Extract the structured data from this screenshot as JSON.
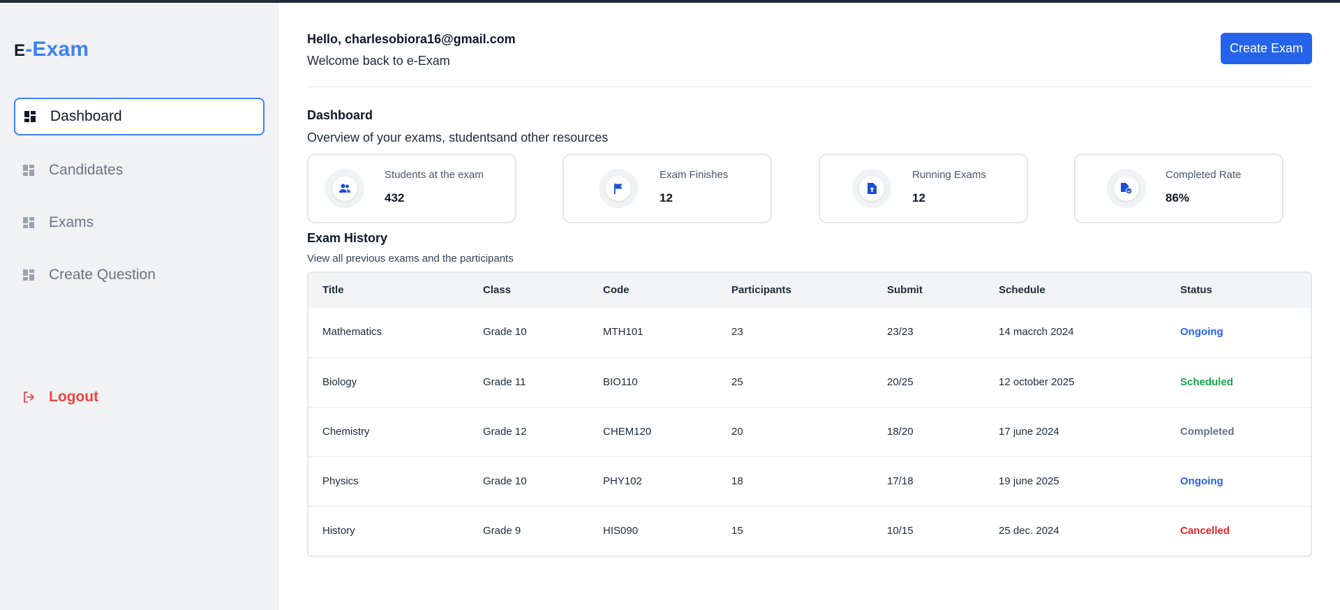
{
  "brand": {
    "prefix": "E",
    "rest": "-Exam",
    "accent": "#3b82f6"
  },
  "sidebar": {
    "items": [
      {
        "label": "Dashboard",
        "icon": "dashboard-icon",
        "active": true
      },
      {
        "label": "Candidates",
        "icon": "dashboard-icon",
        "active": false
      },
      {
        "label": "Exams",
        "icon": "dashboard-icon",
        "active": false
      },
      {
        "label": "Create Question",
        "icon": "dashboard-icon",
        "active": false
      }
    ],
    "logout": {
      "label": "Logout",
      "icon": "logout-icon",
      "color": "#ef4444"
    }
  },
  "header": {
    "greeting": "Hello, charlesobiora16@gmail.com",
    "welcome": "Welcome back to e-Exam",
    "create_button": "Create Exam"
  },
  "dashboard": {
    "title": "Dashboard",
    "subtitle": "Overview of your exams, studentsand other resources",
    "cards": [
      {
        "label": "Students at the exam",
        "value": "432",
        "icon": "users-icon"
      },
      {
        "label": "Exam Finishes",
        "value": "12",
        "icon": "flag-icon"
      },
      {
        "label": "Running Exams",
        "value": "12",
        "icon": "file-upload-icon"
      },
      {
        "label": "Completed Rate",
        "value": "86%",
        "icon": "file-check-icon"
      }
    ]
  },
  "history": {
    "title": "Exam History",
    "subtitle": "View all previous exams and the participants",
    "columns": [
      "Title",
      "Class",
      "Code",
      "Participants",
      "Submit",
      "Schedule",
      "Status"
    ],
    "rows": [
      {
        "title": "Mathematics",
        "class": "Grade 10",
        "code": "MTH101",
        "participants": "23",
        "submit": "23/23",
        "schedule": "14 macrch 2024",
        "status": "Ongoing",
        "status_color": "#2563eb"
      },
      {
        "title": "Biology",
        "class": "Grade 11",
        "code": "BIO110",
        "participants": "25",
        "submit": "20/25",
        "schedule": "12 october 2025",
        "status": "Scheduled",
        "status_color": "#16a34a"
      },
      {
        "title": "Chemistry",
        "class": "Grade 12",
        "code": "CHEM120",
        "participants": "20",
        "submit": "18/20",
        "schedule": "17 june 2024",
        "status": "Completed",
        "status_color": "#6b7280"
      },
      {
        "title": "Physics",
        "class": "Grade 10",
        "code": "PHY102",
        "participants": "18",
        "submit": "17/18",
        "schedule": "19 june 2025",
        "status": "Ongoing",
        "status_color": "#2563eb"
      },
      {
        "title": "History",
        "class": "Grade 9",
        "code": "HIS090",
        "participants": "15",
        "submit": "10/15",
        "schedule": "25 dec. 2024",
        "status": "Cancelled",
        "status_color": "#dc2626"
      }
    ]
  }
}
